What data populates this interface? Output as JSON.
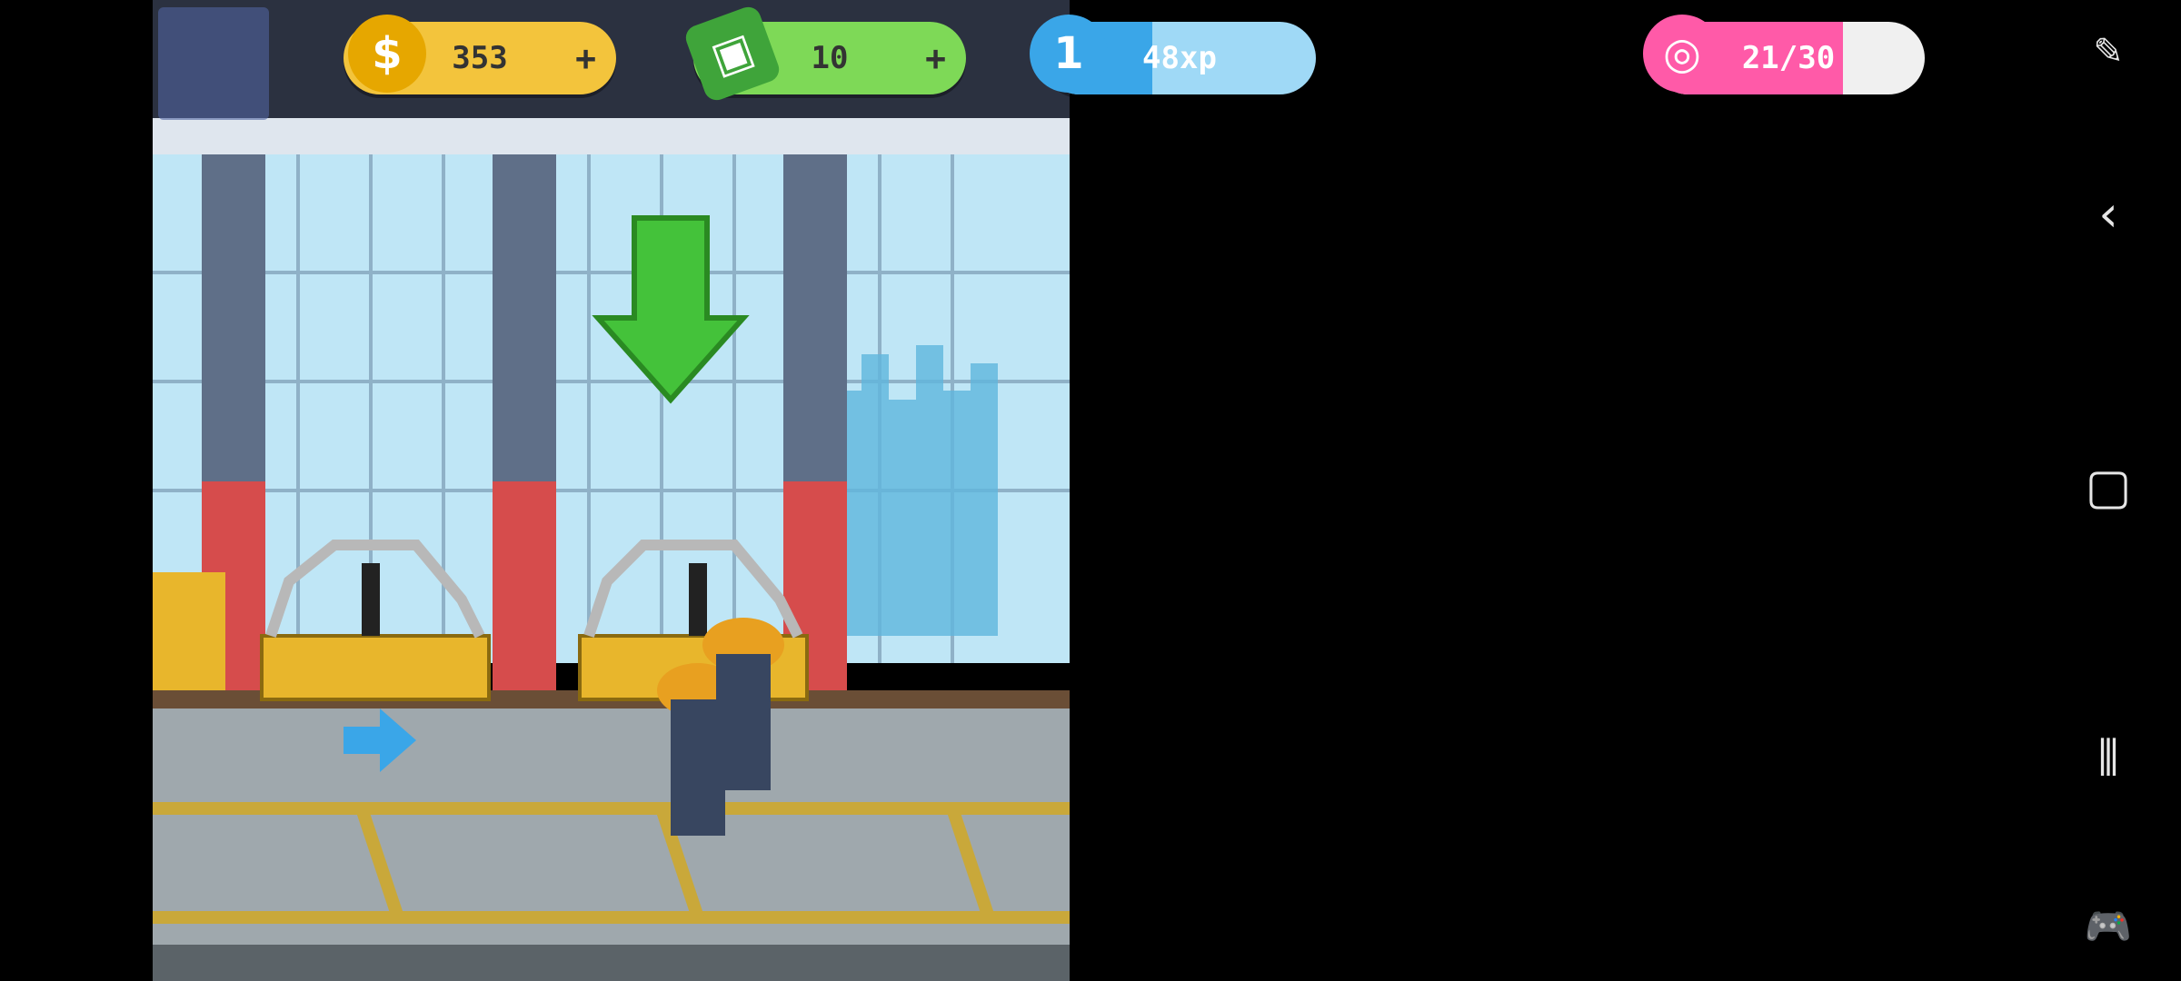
{
  "hud": {
    "coins": "353",
    "cash": "10",
    "level": "1",
    "xp": "48xp",
    "xp_progress": 0.4,
    "donuts": "21/30",
    "donut_progress": 0.7,
    "plus": "+"
  },
  "colors": {
    "coin": "#f3c43c",
    "cash": "#7ed957",
    "xp": "#78c8f0",
    "donut": "#ff5aa8",
    "arrow_green": "#44c23a",
    "arrow_blue": "#3aa6e8"
  },
  "icons": {
    "map": "map-icon",
    "coin": "coin-icon",
    "cash": "cash-icon",
    "level": "level-star-icon",
    "donut": "donut-icon",
    "down_arrow": "down-arrow-icon",
    "right_arrow": "right-arrow-icon"
  }
}
